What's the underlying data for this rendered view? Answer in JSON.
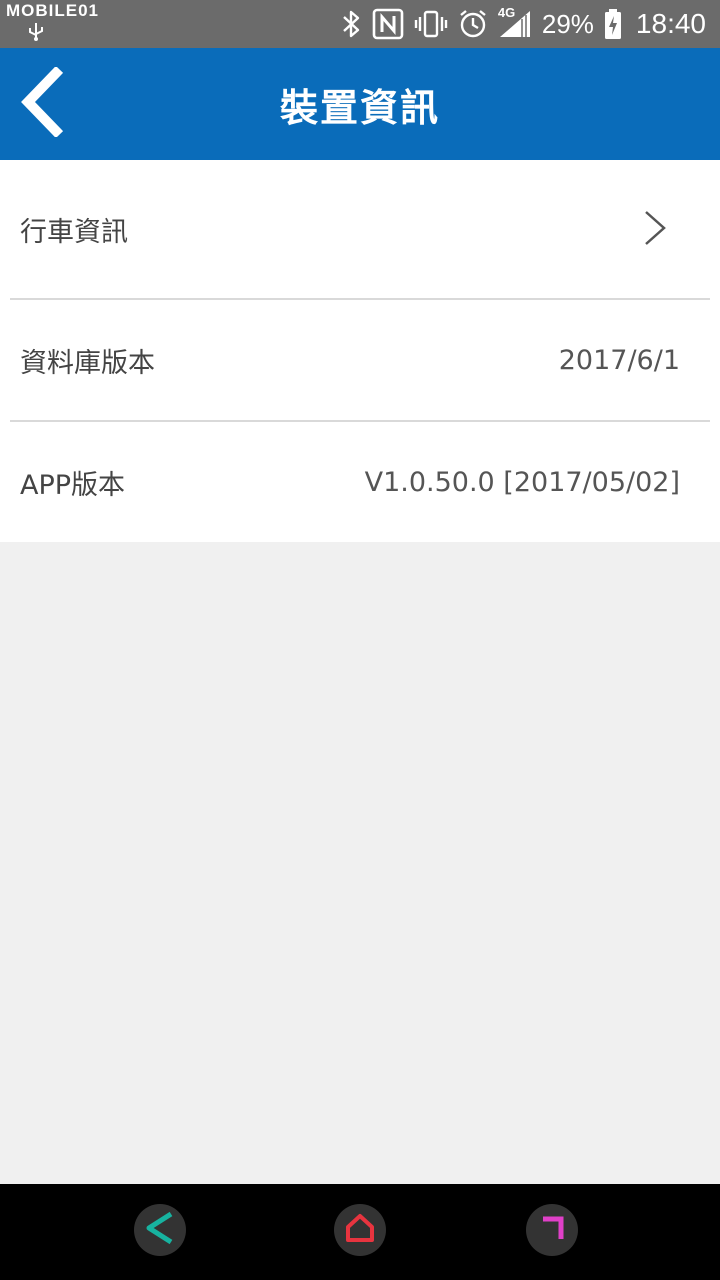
{
  "status_bar": {
    "watermark": "MOBILE01",
    "battery_percent": "29%",
    "time": "18:40",
    "network_label": "4G",
    "icons": [
      "usb-icon",
      "bluetooth-icon",
      "nfc-icon",
      "vibrate-icon",
      "alarm-icon",
      "signal-icon",
      "battery-charging-icon"
    ]
  },
  "app_bar": {
    "title": "裝置資訊",
    "back_icon": "chevron-left-icon",
    "color": "#0a6cba"
  },
  "list": {
    "items": [
      {
        "label": "行車資訊",
        "value": "",
        "icon": "chevron-right-icon"
      },
      {
        "label": "資料庫版本",
        "value": "2017/6/1"
      },
      {
        "label": "APP版本",
        "value": "V1.0.50.0 [2017/05/02]"
      }
    ]
  },
  "nav_bar": {
    "buttons": [
      {
        "name": "back",
        "icon": "back-arrow-icon",
        "color": "#17b3a0"
      },
      {
        "name": "home",
        "icon": "home-icon",
        "color": "#e8343f"
      },
      {
        "name": "recents",
        "icon": "recents-icon",
        "color": "#e040c8"
      }
    ]
  }
}
